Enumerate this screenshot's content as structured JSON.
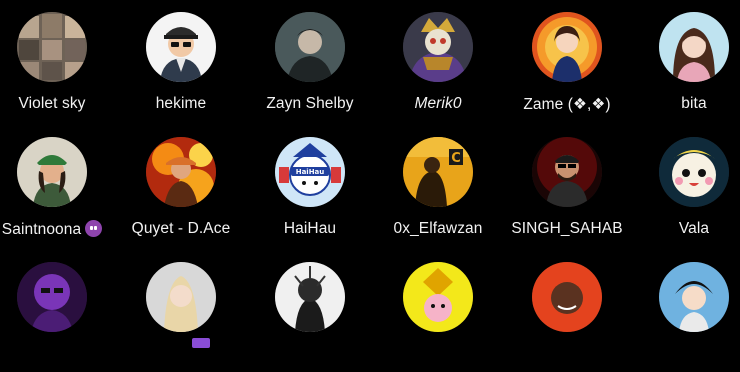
{
  "row1": [
    {
      "name": "Violet sky"
    },
    {
      "name": "hekime"
    },
    {
      "name": "Zayn Shelby"
    },
    {
      "name": "Merik0"
    },
    {
      "name": "Zame (❖,❖)"
    },
    {
      "name": "bita"
    }
  ],
  "row2": [
    {
      "name": "Saintnoona"
    },
    {
      "name": "Quyet - D.Ace"
    },
    {
      "name": "HaiHau"
    },
    {
      "name": "0x_Elfawzan"
    },
    {
      "name": "SINGH_SAHAB"
    },
    {
      "name": "Vala"
    }
  ],
  "avatar_text": {
    "haihau": "HaiHau",
    "c_letter": "C"
  },
  "colors": {
    "background": "#000000",
    "text": "#f2f2f2"
  }
}
